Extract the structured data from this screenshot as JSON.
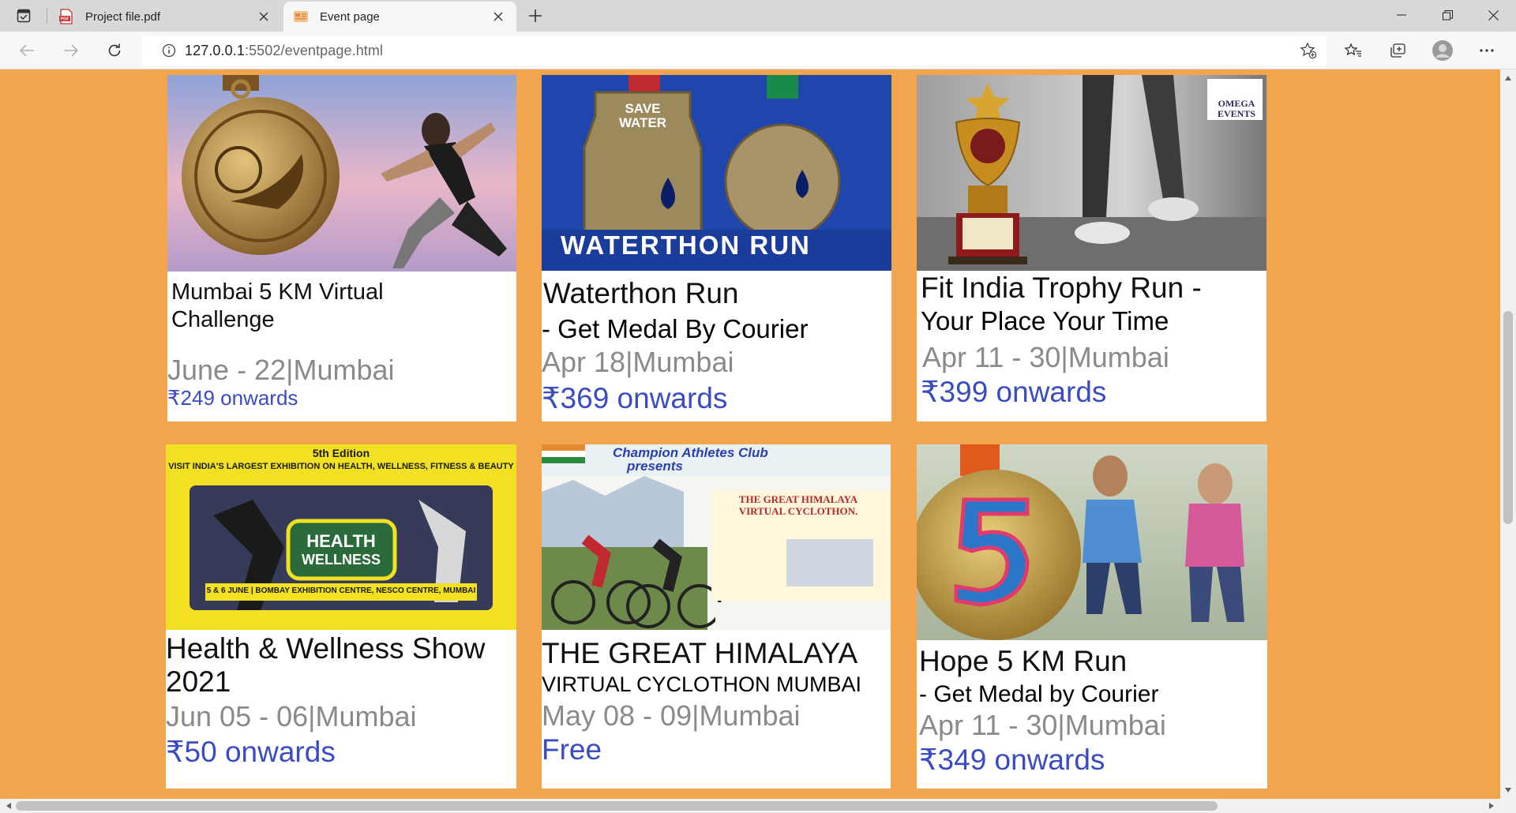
{
  "browser": {
    "tabs": [
      {
        "title": "Project file.pdf",
        "icon": "pdf-icon",
        "active": false
      },
      {
        "title": "Event page",
        "icon": "page-favicon-icon",
        "active": true
      }
    ],
    "url_host": "127.0.0.1",
    "url_path": ":5502/eventpage.html"
  },
  "events": [
    {
      "title_line1": "Mumbai 5 KM Virtual",
      "title_line2": "Challenge",
      "date": "June - 22|Mumbai",
      "price": "₹249 onwards",
      "image_caption": ""
    },
    {
      "title_line1": "Waterthon Run",
      "title_line2": "- Get Medal By Courier",
      "date": "Apr 18|Mumbai",
      "price": "₹369 onwards",
      "image_caption": "WATERTHON RUN"
    },
    {
      "title_line1": "Fit India Trophy Run -",
      "title_line2": "Your Place Your Time",
      "date": "Apr 11 - 30|Mumbai",
      "price": "₹399 onwards",
      "image_caption": "OMEGA EVENTS"
    },
    {
      "title_line1": "Health & Wellness Show",
      "title_line2": "2021",
      "date": "Jun 05 - 06|Mumbai",
      "price": "₹50 onwards",
      "image_caption": "5th Edition",
      "image_subcaption": "VISIT INDIA'S LARGEST EXHIBITION ON HEALTH, WELLNESS, FITNESS & BEAUTY",
      "image_footer": "5 & 6 JUNE  |  BOMBAY EXHIBITION CENTRE, NESCO CENTRE, MUMBAI"
    },
    {
      "title_line1": "THE GREAT HIMALAYA",
      "title_line2": "VIRTUAL CYCLOTHON MUMBAI",
      "date": "May 08 - 09|Mumbai",
      "price": "Free",
      "image_caption": "Champion Athletes Club",
      "image_subcaption": "presents"
    },
    {
      "title_line1": "Hope 5 KM Run",
      "title_line2": "- Get Medal by Courier",
      "date": "Apr 11 - 30|Mumbai",
      "price": "₹349 onwards",
      "image_caption": ""
    }
  ],
  "colors": {
    "page_bg": "#f3a54d",
    "price": "#3a4bc4",
    "date": "#8a8a8a"
  }
}
